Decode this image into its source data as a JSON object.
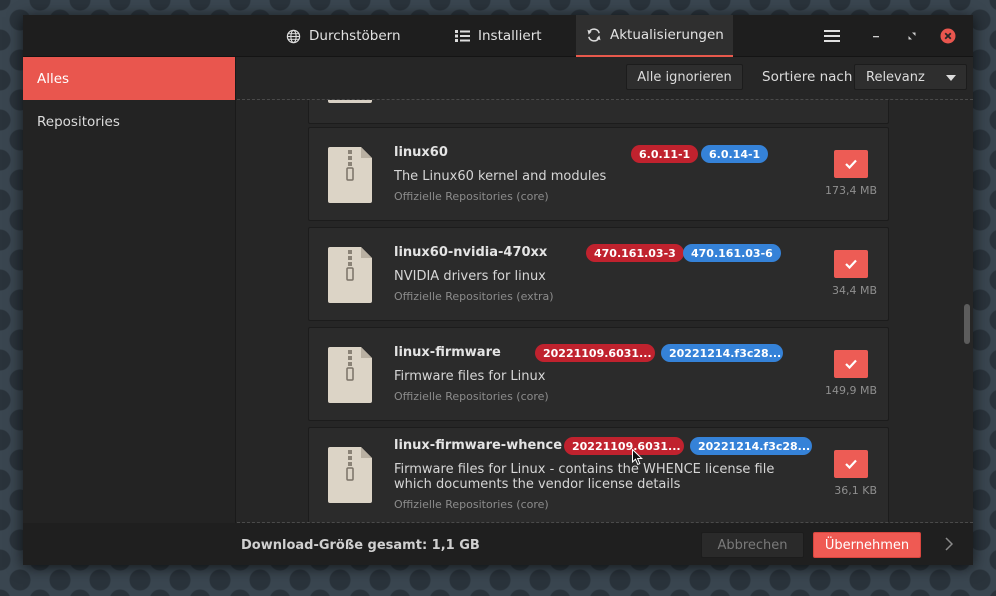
{
  "header": {
    "tabs": [
      {
        "label": "Durchstöbern",
        "icon": "globe-icon"
      },
      {
        "label": "Installiert",
        "icon": "list-icon"
      },
      {
        "label": "Aktualisierungen",
        "icon": "refresh-icon"
      }
    ],
    "active_tab": 2
  },
  "sidebar": {
    "items": [
      {
        "label": "Alles"
      },
      {
        "label": "Repositories"
      }
    ],
    "active_item": 0
  },
  "toolbar": {
    "ignore_all_label": "Alle ignorieren",
    "sort_label": "Sortiere nach",
    "sort_value": "Relevanz"
  },
  "packages": [
    {
      "name": "linux60",
      "old_version": "6.0.11-1",
      "new_version": "6.0.14-1",
      "description": "The Linux60 kernel and modules",
      "repository": "Offizielle Repositories (core)",
      "size": "173,4 MB",
      "selected": true
    },
    {
      "name": "linux60-nvidia-470xx",
      "old_version": "470.161.03-3",
      "new_version": "470.161.03-6",
      "description": "NVIDIA drivers for linux",
      "repository": "Offizielle Repositories (extra)",
      "size": "34,4 MB",
      "selected": true
    },
    {
      "name": "linux-firmware",
      "old_version": "20221109.6031...",
      "new_version": "20221214.f3c28...",
      "description": "Firmware files for Linux",
      "repository": "Offizielle Repositories (core)",
      "size": "149,9 MB",
      "selected": true
    },
    {
      "name": "linux-firmware-whence",
      "old_version": "20221109.6031...",
      "new_version": "20221214.f3c28...",
      "description_line1": "Firmware files for Linux - contains the WHENCE license file",
      "description_line2": "which documents the vendor license details",
      "repository": "Offizielle Repositories (core)",
      "size": "36,1 KB",
      "selected": true
    }
  ],
  "footer": {
    "total_label": "Download-Größe gesamt: 1,1 GB",
    "cancel_label": "Abbrechen",
    "apply_label": "Übernehmen"
  },
  "colors": {
    "accent": "#e9564e",
    "old_version_badge": "#c0222e",
    "new_version_badge": "#3582d8"
  }
}
